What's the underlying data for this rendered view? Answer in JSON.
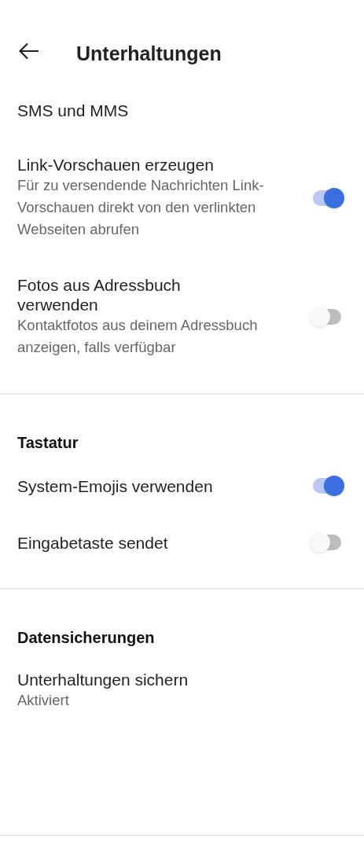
{
  "header": {
    "title": "Unterhaltungen"
  },
  "sections": [
    {
      "items": [
        {
          "kind": "plain",
          "title": "SMS und MMS"
        },
        {
          "kind": "switch",
          "title": "Link-Vorschauen erzeugen",
          "summary": "Für zu versendende Nachrichten Link-Vorschauen direkt von den verlinkten Webseiten abrufen",
          "on": true
        },
        {
          "kind": "switch",
          "title": "Fotos aus Adressbuch verwenden",
          "summary": "Kontaktfotos aus deinem Adressbuch anzeigen, falls verfügbar",
          "on": false
        }
      ]
    },
    {
      "header": "Tastatur",
      "items": [
        {
          "kind": "switch",
          "title": "System-Emojis verwenden",
          "on": true
        },
        {
          "kind": "switch",
          "title": "Eingabetaste sendet",
          "on": false
        }
      ]
    },
    {
      "header": "Datensicherungen",
      "items": [
        {
          "kind": "plain",
          "title": "Unterhaltungen sichern",
          "summary": "Aktiviert"
        }
      ]
    }
  ]
}
